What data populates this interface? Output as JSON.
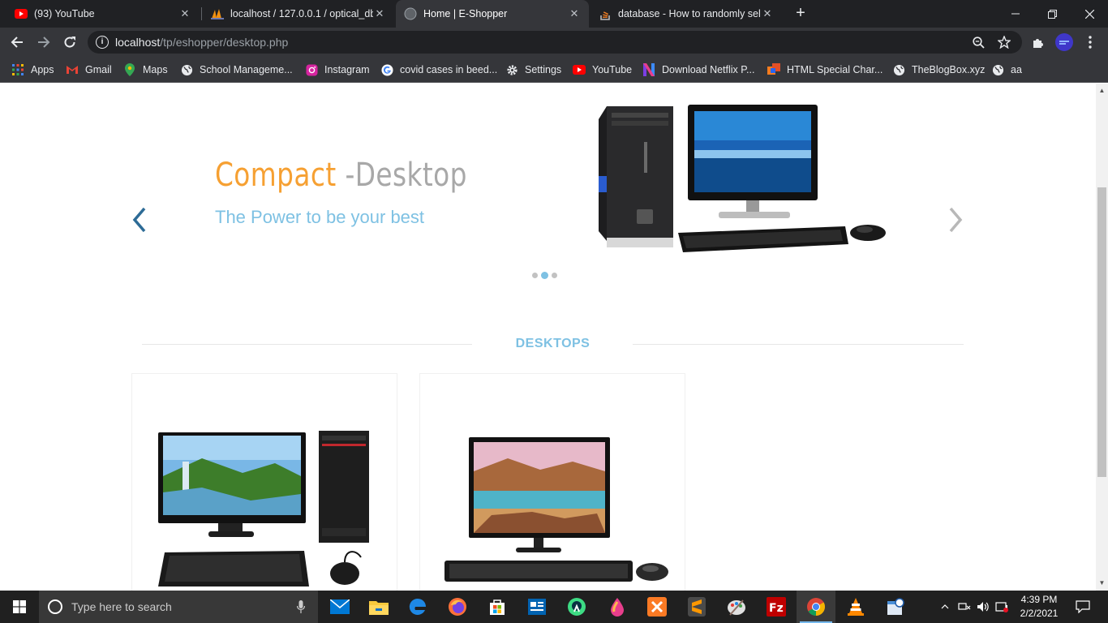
{
  "browser": {
    "tabs": [
      {
        "title": "(93) YouTube",
        "icon": "youtube-icon",
        "active": false
      },
      {
        "title": "localhost / 127.0.0.1 / optical_db",
        "icon": "phpmyadmin-icon",
        "active": false
      },
      {
        "title": "Home | E-Shopper",
        "icon": "globe-icon",
        "active": true
      },
      {
        "title": "database - How to randomly sele",
        "icon": "stackoverflow-icon",
        "active": false
      }
    ],
    "url_host": "localhost",
    "url_path": "/tp/eshopper/desktop.php",
    "bookmarks": [
      {
        "label": "Apps",
        "icon": "apps-grid-icon"
      },
      {
        "label": "Gmail",
        "icon": "gmail-icon"
      },
      {
        "label": "Maps",
        "icon": "maps-pin-icon"
      },
      {
        "label": "School Manageme...",
        "icon": "globe-icon"
      },
      {
        "label": "Instagram",
        "icon": "instagram-icon"
      },
      {
        "label": "covid cases in beed...",
        "icon": "google-icon"
      },
      {
        "label": "Settings",
        "icon": "gear-icon"
      },
      {
        "label": "YouTube",
        "icon": "youtube-icon"
      },
      {
        "label": "Download Netflix P...",
        "icon": "netflix-icon"
      },
      {
        "label": "HTML Special Char...",
        "icon": "html-icon"
      },
      {
        "label": "TheBlogBox.xyz",
        "icon": "globe-icon"
      },
      {
        "label": "aa",
        "icon": "globe-icon"
      }
    ]
  },
  "page": {
    "slider": {
      "title_accent": "Compact",
      "title_rest": " -Desktop",
      "subtitle": "The Power to be your best",
      "active_slide_index": 1,
      "slide_count": 3
    },
    "section_title": "DESKTOPS",
    "products": [
      {
        "image": "desktop-pc-with-tower-image"
      },
      {
        "image": "desktop-monitor-keyboard-image"
      }
    ]
  },
  "taskbar": {
    "search_placeholder": "Type here to search",
    "time": "4:39 PM",
    "date": "2/2/2021"
  },
  "colors": {
    "accent_orange": "#f6a032",
    "accent_blue": "#7ec1e3",
    "title_gray": "#a8a8a8"
  }
}
